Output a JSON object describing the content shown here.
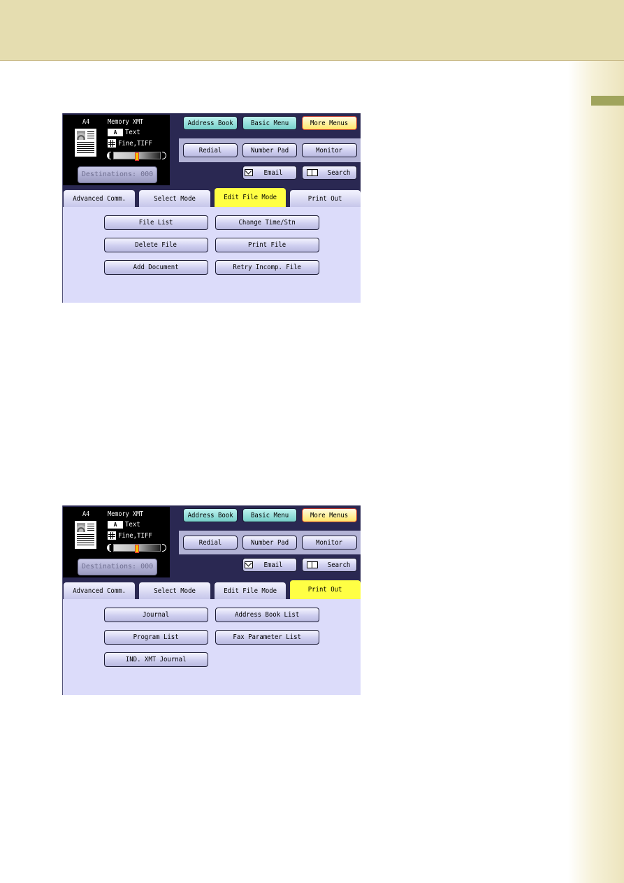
{
  "panels": [
    {
      "status": {
        "paper_size": "A4",
        "mode": "Memory XMT",
        "original_type": "Text",
        "resolution_format": "Fine,TIFF",
        "contrast_level": 0.5,
        "destinations_label": "Destinations: 000"
      },
      "top_buttons": [
        "Address Book",
        "Basic Menu",
        "More Menus"
      ],
      "mid_buttons": [
        "Redial",
        "Number Pad",
        "Monitor"
      ],
      "email_label": "Email",
      "search_label": "Search",
      "tabs": [
        "Advanced Comm.",
        "Select Mode",
        "Edit File Mode",
        "Print Out"
      ],
      "active_tab": "Edit File Mode",
      "buttons": [
        "File List",
        "Change Time/Stn",
        "Delete File",
        "Print File",
        "Add Document",
        "Retry Incomp. File"
      ]
    },
    {
      "status": {
        "paper_size": "A4",
        "mode": "Memory XMT",
        "original_type": "Text",
        "resolution_format": "Fine,TIFF",
        "contrast_level": 0.5,
        "destinations_label": "Destinations: 000"
      },
      "top_buttons": [
        "Address Book",
        "Basic Menu",
        "More Menus"
      ],
      "mid_buttons": [
        "Redial",
        "Number Pad",
        "Monitor"
      ],
      "email_label": "Email",
      "search_label": "Search",
      "tabs": [
        "Advanced Comm.",
        "Select Mode",
        "Edit File Mode",
        "Print Out"
      ],
      "active_tab": "Print Out",
      "buttons": [
        "Journal",
        "Address Book List",
        "Program List",
        "Fax Parameter List",
        "IND. XMT Journal"
      ]
    }
  ],
  "colors": {
    "header_band": "#e5ddb0",
    "panel_bg": "#dcdcfa",
    "active_tab": "#ffff44",
    "cyan_button": "#76cfc9",
    "yellow_button": "#ffe76a"
  }
}
